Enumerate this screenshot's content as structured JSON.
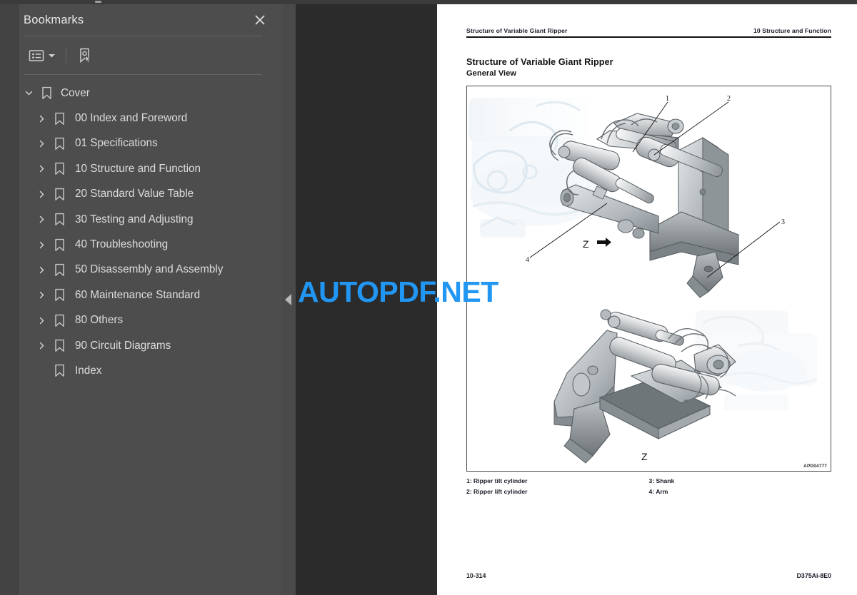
{
  "window": {
    "accent_blue": "#2196f3",
    "sidebar_bg": "#4d4d4d",
    "viewer_bg": "#2b2b2b"
  },
  "sidebar": {
    "title": "Bookmarks",
    "close_label": "×",
    "toolbar": {
      "options_icon": "list-options-icon",
      "caret_icon": "chevron-down-icon",
      "new_bookmark_icon": "bookmark-pointer-icon"
    },
    "items": [
      {
        "label": "Cover",
        "level": 0,
        "twisty": "expanded"
      },
      {
        "label": "00 Index and Foreword",
        "level": 1,
        "twisty": "collapsed"
      },
      {
        "label": "01 Specifications",
        "level": 1,
        "twisty": "collapsed"
      },
      {
        "label": "10 Structure and Function",
        "level": 1,
        "twisty": "collapsed"
      },
      {
        "label": "20 Standard Value Table",
        "level": 1,
        "twisty": "collapsed"
      },
      {
        "label": "30 Testing and Adjusting",
        "level": 1,
        "twisty": "collapsed"
      },
      {
        "label": "40 Troubleshooting",
        "level": 1,
        "twisty": "collapsed"
      },
      {
        "label": "50 Disassembly and Assembly",
        "level": 1,
        "twisty": "collapsed"
      },
      {
        "label": "60 Maintenance Standard",
        "level": 1,
        "twisty": "collapsed"
      },
      {
        "label": "80 Others",
        "level": 1,
        "twisty": "collapsed"
      },
      {
        "label": "90 Circuit Diagrams",
        "level": 1,
        "twisty": "collapsed"
      },
      {
        "label": "Index",
        "level": 1,
        "twisty": "none"
      }
    ]
  },
  "splitter": {
    "collapse_icon": "triangle-left-icon"
  },
  "watermark": {
    "text": "AUTOPDF.NET"
  },
  "document": {
    "running_head_left": "Structure of Variable Giant Ripper",
    "running_head_right": "10 Structure and Function",
    "title": "Structure of Variable Giant Ripper",
    "subtitle": "General View",
    "figure": {
      "code": "APD04777",
      "view_marker_top": "Z",
      "view_marker_bottom": "Z",
      "callouts": [
        "1",
        "2",
        "3",
        "4"
      ]
    },
    "legend": {
      "left": [
        "1: Ripper tilt cylinder",
        "2: Ripper lift cylinder"
      ],
      "right": [
        "3: Shank",
        "4: Arm"
      ]
    },
    "footer_left": "10-314",
    "footer_right": "D375Ai-8E0"
  }
}
